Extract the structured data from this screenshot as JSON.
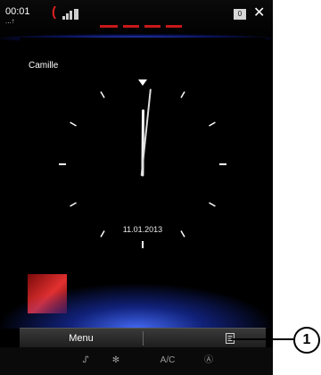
{
  "status": {
    "time": "00:01",
    "sub_icon": "...↑",
    "phone_icon": "phone-icon",
    "signal_icon": "signal-icon",
    "notification_icon": "notification-icon",
    "notification_count": "0",
    "close_icon": "close-icon"
  },
  "profile": {
    "name": "Camille"
  },
  "clock": {
    "date": "11.01.2013",
    "hours": 12,
    "minutes": 1
  },
  "toolbar": {
    "menu_label": "Menu",
    "list_icon": "list-icon"
  },
  "nav": {
    "items": [
      {
        "icon": "airflow-icon",
        "glyph": "ᔑ"
      },
      {
        "icon": "fan-icon",
        "glyph": "✻"
      },
      {
        "icon": "ac-icon",
        "label": "A/C"
      },
      {
        "icon": "auto-climate-icon",
        "glyph": "Ⓐ"
      }
    ]
  },
  "callout": {
    "number": "1"
  },
  "colors": {
    "accent": "#c81818",
    "glow": "#3c5aff",
    "background": "#000000"
  }
}
